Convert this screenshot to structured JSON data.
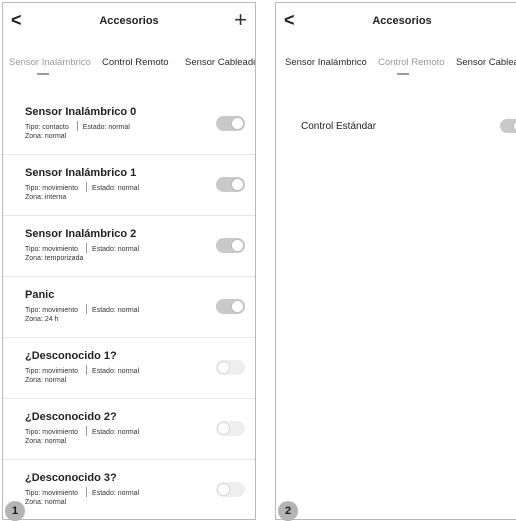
{
  "screen1": {
    "header": {
      "back_icon": "chevron-left-icon",
      "back_glyph": "<",
      "title": "Accesorios",
      "add_icon": "plus-icon",
      "add_glyph": "+"
    },
    "tabs": [
      "Sensor Inalámbrico",
      "Control Remoto",
      "Sensor Cableado"
    ],
    "active_tab": 0,
    "items": [
      {
        "name": "Sensor Inalámbrico 0",
        "tipo": "Tipo: contacto",
        "estado": "Estado: normal",
        "zona": "Zona: normal",
        "enabled": true
      },
      {
        "name": "Sensor Inalámbrico 1",
        "tipo": "Tipo: movimiento",
        "estado": "Estado: normal",
        "zona": "Zona: interna",
        "enabled": true
      },
      {
        "name": "Sensor Inalámbrico 2",
        "tipo": "Tipo: movimiento",
        "estado": "Estado: normal",
        "zona": "Zona: temporizada",
        "enabled": true
      },
      {
        "name": "Panic",
        "tipo": "Tipo: movimiento",
        "estado": "Estado: normal",
        "zona": "Zona: 24 h",
        "enabled": true
      },
      {
        "name": "¿Desconocido 1?",
        "tipo": "Tipo: movimiento",
        "estado": "Estado: normal",
        "zona": "Zona: normal",
        "enabled": false
      },
      {
        "name": "¿Desconocido 2?",
        "tipo": "Tipo: movimiento",
        "estado": "Estado: normal",
        "zona": "Zona: normal",
        "enabled": false
      },
      {
        "name": "¿Desconocido 3?",
        "tipo": "Tipo: movimiento",
        "estado": "Estado: normal",
        "zona": "Zona: normal",
        "enabled": false
      }
    ],
    "badge": "1"
  },
  "screen2": {
    "header": {
      "back_icon": "chevron-left-icon",
      "back_glyph": "<",
      "title": "Accesorios",
      "add_icon": "plus-icon",
      "add_glyph": "+"
    },
    "tabs": [
      "Sensor Inalámbrico",
      "Control Remoto",
      "Sensor Cableado"
    ],
    "active_tab": 1,
    "items": [
      {
        "name": "Control Estándar",
        "enabled": true
      }
    ],
    "badge": "2"
  },
  "colors": {
    "active_tab": "#9a9a9a",
    "toggle_on": "#c9c9c9",
    "toggle_off": "#eeeeee",
    "badge": "#b4b4b4"
  }
}
